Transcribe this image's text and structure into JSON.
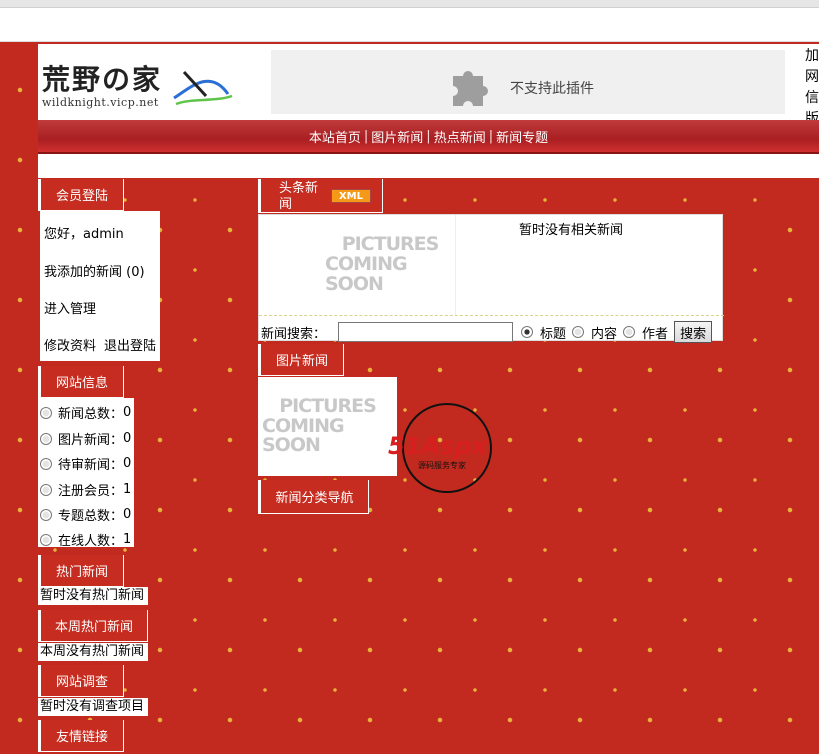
{
  "header": {
    "logo_title": "荒野の家",
    "logo_url": "wildknight.vicp.net",
    "plugin_text": "不支持此插件",
    "right_chars": [
      "加",
      "网",
      "信",
      "版"
    ]
  },
  "nav": {
    "items": [
      "本站首页",
      "图片新闻",
      "热点新闻",
      "新闻专题"
    ],
    "separator": "|"
  },
  "sidebar": {
    "member_title": "会员登陆",
    "greeting": "您好，admin",
    "my_news": "我添加的新闻 (0)",
    "manage": "进入管理",
    "edit_profile": "修改资料",
    "logout": "退出登陆",
    "site_info_title": "网站信息",
    "stats": [
      {
        "label": "新闻总数：",
        "value": "0"
      },
      {
        "label": "图片新闻：",
        "value": "0"
      },
      {
        "label": "待审新闻：",
        "value": "0"
      },
      {
        "label": "注册会员：",
        "value": "1"
      },
      {
        "label": "专题总数：",
        "value": "0"
      },
      {
        "label": "在线人数：",
        "value": "1"
      }
    ],
    "hot_news_title": "热门新闻",
    "hot_news_text": "暂时没有热门新闻",
    "week_hot_title": "本周热门新闻",
    "week_hot_text": "本周没有热门新闻",
    "survey_title": "网站调查",
    "survey_text": "暂时没有调查项目",
    "links_title": "友情链接"
  },
  "main": {
    "headline_tab": "头条新闻",
    "xml_badge": "XML",
    "pic_line1": "PICTURES",
    "pic_line2": "COMING SOON",
    "no_news": "暂时没有相关新闻",
    "search_label": "新闻搜索：",
    "search_value": "",
    "opt_title": "标题",
    "opt_content": "内容",
    "opt_author": "作者",
    "search_button": "搜索",
    "pic_news_tab": "图片新闻",
    "category_tab": "新闻分类导航",
    "aspx_brand": "51Aspx",
    "aspx_tagline": "源码服务专家"
  },
  "colors": {
    "background": "#c32a1f",
    "nav": "#a91f22",
    "xml_badge": "#f59a18"
  }
}
